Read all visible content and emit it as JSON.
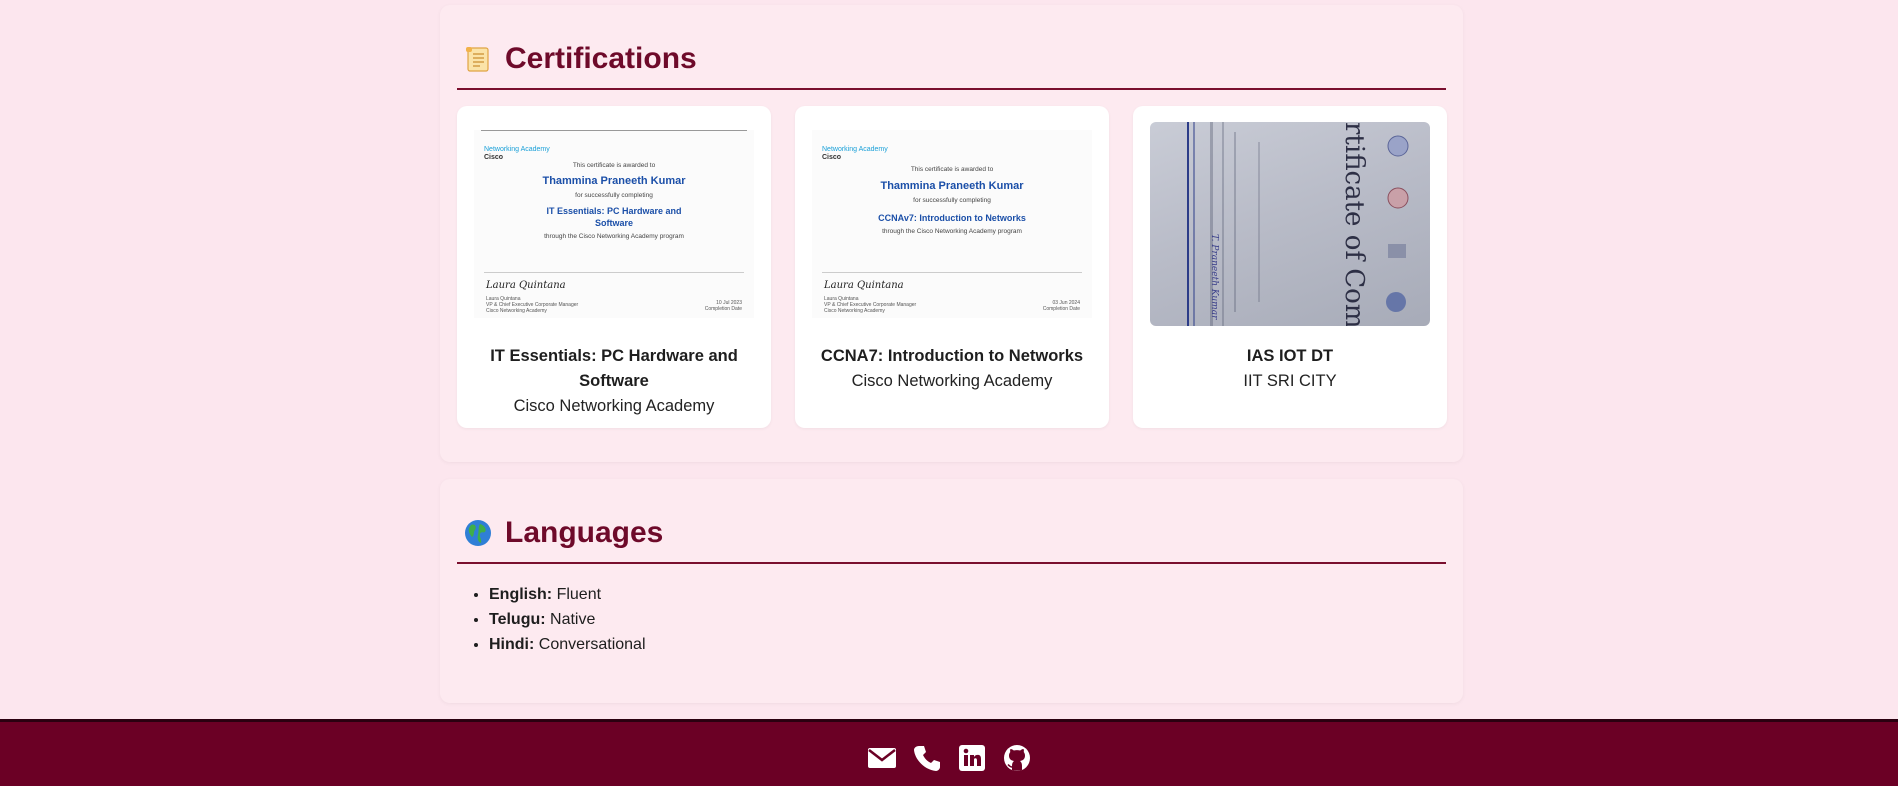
{
  "certifications": {
    "heading": "Certifications",
    "heading_icon": "scroll-icon",
    "items": [
      {
        "title": "IT Essentials: PC Hardware and Software",
        "issuer": "Cisco Networking Academy",
        "preview": {
          "logo_top": "Cisco",
          "logo_sub": "Networking Academy",
          "lead": "This certificate is awarded to",
          "name": "Thammina Praneeth Kumar",
          "for_text": "for successfully completing",
          "course": "IT Essentials: PC Hardware and Software",
          "program": "through the Cisco Networking Academy program",
          "signature": "Laura Quintana",
          "signer_lines": [
            "Laura Quintana",
            "VP & Chief Executive Corporate Manager",
            "Cisco Networking Academy"
          ],
          "date": "10 Jul 2023",
          "date_label": "Completion Date"
        }
      },
      {
        "title": "CCNA7: Introduction to Networks",
        "issuer": "Cisco Networking Academy",
        "preview": {
          "logo_top": "Cisco",
          "logo_sub": "Networking Academy",
          "lead": "This certificate is awarded to",
          "name": "Thammina Praneeth Kumar",
          "for_text": "for successfully completing",
          "course": "CCNAv7: Introduction to Networks",
          "program": "through the Cisco Networking Academy program",
          "signature": "Laura Quintana",
          "signer_lines": [
            "Laura Quintana",
            "VP & Chief Executive Corporate Manager",
            "Cisco Networking Academy"
          ],
          "date": "03 Jun 2024",
          "date_label": "Completion Date"
        }
      },
      {
        "title": "IAS IOT DT",
        "issuer": "IIT SRI CITY",
        "preview": {
          "photo_text": "rtificate of Comple",
          "handwritten_name": "T. Praneeth Kumar"
        }
      }
    ]
  },
  "languages": {
    "heading": "Languages",
    "heading_icon": "globe-icon",
    "items": [
      {
        "name": "English:",
        "level": "Fluent"
      },
      {
        "name": "Telugu:",
        "level": "Native"
      },
      {
        "name": "Hindi:",
        "level": "Conversational"
      }
    ]
  },
  "footer": {
    "icons": [
      "email-icon",
      "phone-icon",
      "linkedin-icon",
      "github-icon"
    ]
  },
  "colors": {
    "page_bg": "#fce6ee",
    "accent": "#6e0a2a",
    "footer_bg": "#6b0025"
  }
}
